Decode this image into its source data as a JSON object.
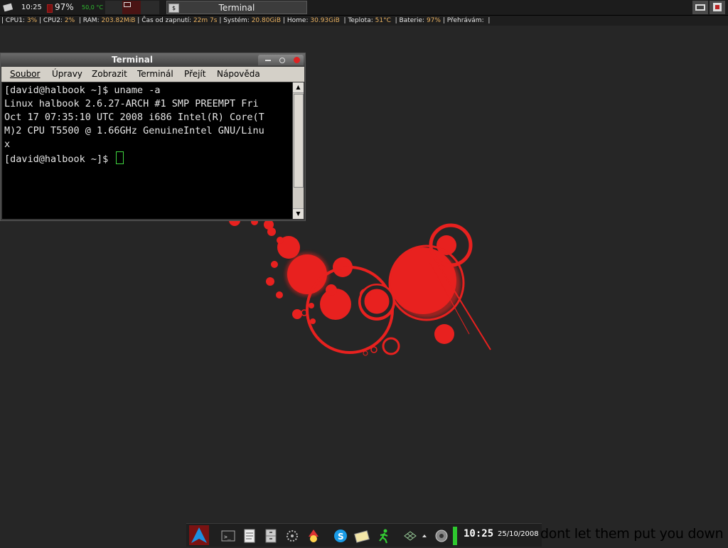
{
  "top_panel": {
    "clock": "10:25",
    "battery": "97%",
    "temp": "50,0 °C",
    "task_title": "Terminal"
  },
  "sysbar": {
    "cpu1_label": "CPU1:",
    "cpu1": "3%",
    "cpu2_label": "CPU2:",
    "cpu2": "2%",
    "ram_label": "RAM:",
    "ram": "203.82MiB",
    "uptime_label": "Čas od zapnutí:",
    "uptime": "22m 7s",
    "system_label": "Systém:",
    "system": "20.80GiB",
    "home_label": "Home:",
    "home": "30.93GiB",
    "temp_label": "Teplota:",
    "temp": "51°C",
    "battery_label": "Baterie:",
    "battery": "97%",
    "playing_label": "Přehrávám:"
  },
  "terminal": {
    "title": "Terminal",
    "menu": [
      "Soubor",
      "Úpravy",
      "Zobrazit",
      "Terminál",
      "Přejít",
      "Nápověda"
    ],
    "lines": [
      "[david@halbook ~]$ uname -a",
      "Linux halbook 2.6.27-ARCH #1 SMP PREEMPT Fri",
      "Oct 17 07:35:10 UTC 2008 i686 Intel(R) Core(T",
      "M)2 CPU T5500 @ 1.66GHz GenuineIntel GNU/Linu",
      "x"
    ],
    "prompt": "[david@halbook ~]$ "
  },
  "dock": {
    "clock": "10:25",
    "date": "25/10/2008"
  },
  "wallpaper": {
    "slogan": "dont let them put you down",
    "accent": "#e8211f"
  }
}
